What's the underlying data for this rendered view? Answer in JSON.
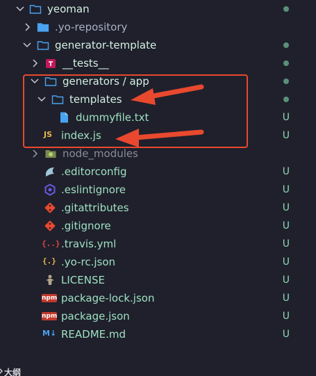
{
  "tree": {
    "root": {
      "label": "yeoman"
    },
    "items": [
      {
        "key": "yo-repository",
        "label": ".yo-repository",
        "status": ""
      },
      {
        "key": "generator-template",
        "label": "generator-template",
        "status": ""
      },
      {
        "key": "tests",
        "label": "__tests__",
        "status": ""
      },
      {
        "key": "generators-app",
        "label": "generators / app",
        "status": ""
      },
      {
        "key": "templates",
        "label": "templates",
        "status": ""
      },
      {
        "key": "dummyfile",
        "label": "dummyfile.txt",
        "status": "U"
      },
      {
        "key": "index-js",
        "label": "index.js",
        "status": "U"
      },
      {
        "key": "node-modules",
        "label": "node_modules",
        "status": ""
      },
      {
        "key": "editorconfig",
        "label": ".editorconfig",
        "status": "U"
      },
      {
        "key": "eslintignore",
        "label": ".eslintignore",
        "status": "U"
      },
      {
        "key": "gitattributes",
        "label": ".gitattributes",
        "status": "U"
      },
      {
        "key": "gitignore",
        "label": ".gitignore",
        "status": "U"
      },
      {
        "key": "travis",
        "label": ".travis.yml",
        "status": "U"
      },
      {
        "key": "yo-rc",
        "label": ".yo-rc.json",
        "status": "U"
      },
      {
        "key": "license",
        "label": "LICENSE",
        "status": "U"
      },
      {
        "key": "package-lock",
        "label": "package-lock.json",
        "status": "U"
      },
      {
        "key": "package",
        "label": "package.json",
        "status": "U"
      },
      {
        "key": "readme",
        "label": "README.md",
        "status": "U"
      }
    ]
  },
  "icons": {
    "js_badge": "JS",
    "md_badge": "M↓",
    "npm_badge": "npm",
    "braces": "{..}",
    "curly": "{.}"
  },
  "outline": {
    "label": "大纲"
  },
  "colors": {
    "background": "#1f202c",
    "untracked": "#8fd8b2",
    "annotation": "#e8492e",
    "folder": "#4aa3f0"
  }
}
